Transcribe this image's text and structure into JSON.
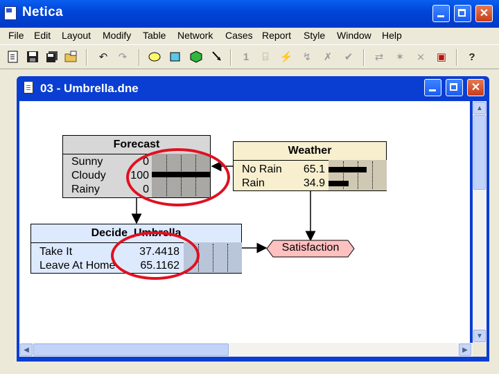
{
  "app": {
    "title": "Netica"
  },
  "menu": [
    "File",
    "Edit",
    "Layout",
    "Modify",
    "Table",
    "Network",
    "Cases",
    "Report",
    "Style",
    "Window",
    "Help"
  ],
  "child_window": {
    "title": "03 - Umbrella.dne"
  },
  "nodes": {
    "forecast": {
      "title": "Forecast",
      "states": [
        {
          "label": "Sunny",
          "value": "0",
          "fraction": 0
        },
        {
          "label": "Cloudy",
          "value": "100",
          "fraction": 1.0
        },
        {
          "label": "Rainy",
          "value": "0",
          "fraction": 0
        }
      ]
    },
    "weather": {
      "title": "Weather",
      "states": [
        {
          "label": "No Rain",
          "value": "65.1",
          "fraction": 0.651
        },
        {
          "label": "Rain",
          "value": "34.9",
          "fraction": 0.349
        }
      ]
    },
    "decide_umbrella": {
      "title": "Decide_Umbrella",
      "states": [
        {
          "label": "Take It",
          "value": "37.4418"
        },
        {
          "label": "Leave At Home",
          "value": "65.1162"
        }
      ]
    },
    "satisfaction": {
      "title": "Satisfaction"
    }
  },
  "colors": {
    "titlebar": "#0a5ff0",
    "forecast_node": "#d7d7d7",
    "weather_node": "#f8efcf",
    "decision_node": "#ddeafe",
    "utility_node": "#ffc0c0",
    "highlight_circle": "#e01020"
  }
}
